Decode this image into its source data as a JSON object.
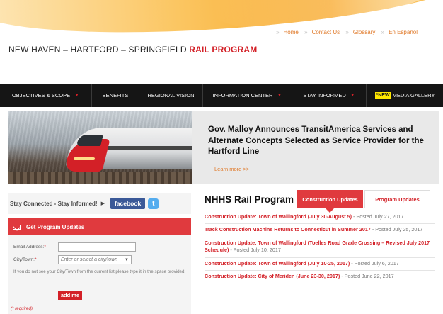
{
  "top_links": [
    "Home",
    "Contact Us",
    "Glossary",
    "En Español"
  ],
  "site_title": {
    "main": "NEW HAVEN – HARTFORD – SPRINGFIELD ",
    "accent": "RAIL PROGRAM"
  },
  "nav": {
    "items": [
      {
        "label": "OBJECTIVES & SCOPE",
        "has_dropdown": true
      },
      {
        "label": "BENEFITS",
        "has_dropdown": false
      },
      {
        "label": "REGIONAL VISION",
        "has_dropdown": false
      },
      {
        "label": "INFORMATION CENTER",
        "has_dropdown": true
      },
      {
        "label": "STAY INFORMED",
        "has_dropdown": true
      },
      {
        "label": "MEDIA GALLERY",
        "badge": "*NEW",
        "has_dropdown": false
      }
    ],
    "caret": "▼"
  },
  "hero": {
    "headline": "Gov. Malloy Announces TransitAmerica Services and Alternate Concepts Selected as Service Provider for the Hartford Line",
    "learn_more": "Learn more >>"
  },
  "social": {
    "stay_text": "Stay Connected - Stay Informed!",
    "arrow": "▶",
    "facebook": "facebook",
    "twitter_icon": "t"
  },
  "updates_form": {
    "header": "Get Program Updates",
    "email_label": "Email Address:",
    "city_label": "City/Town:",
    "required_mark": "*",
    "city_placeholder": "Enter or select a city/town",
    "select_arrow": "▼",
    "help": "If you do not see your City/Town from the current list please type it in the space provided.",
    "submit": "add me",
    "required_note": "(* required)"
  },
  "program": {
    "title": "NHHS Rail Program",
    "tabs": [
      "Construction Updates",
      "Program Updates"
    ],
    "active_tab": 0,
    "items": [
      {
        "title": "Construction Update: Town of Wallingford (July 30-August 5)",
        "posted": " - Posted July 27, 2017"
      },
      {
        "title": "Track Construction Machine Returns to Connecticut in Summer 2017",
        "posted": " - Posted July 25, 2017"
      },
      {
        "title": "Construction Update: Town of Wallingford (Toelles Road Grade Crossing – Revised July 2017 Schedule)",
        "posted": " - Posted July 10, 2017"
      },
      {
        "title": "Construction Update: Town of Wallingford (July 10-25, 2017)",
        "posted": " - Posted July 6, 2017"
      },
      {
        "title": "Construction Update: City of Meriden (June 23-30, 2017)",
        "posted": " - Posted June 22, 2017"
      }
    ]
  },
  "colors": {
    "accent_red": "#d32027",
    "header_red": "#e03a3e",
    "nav_bg": "#151515",
    "link_orange": "#e07a2a",
    "facebook": "#3b5998",
    "twitter": "#55acee"
  }
}
